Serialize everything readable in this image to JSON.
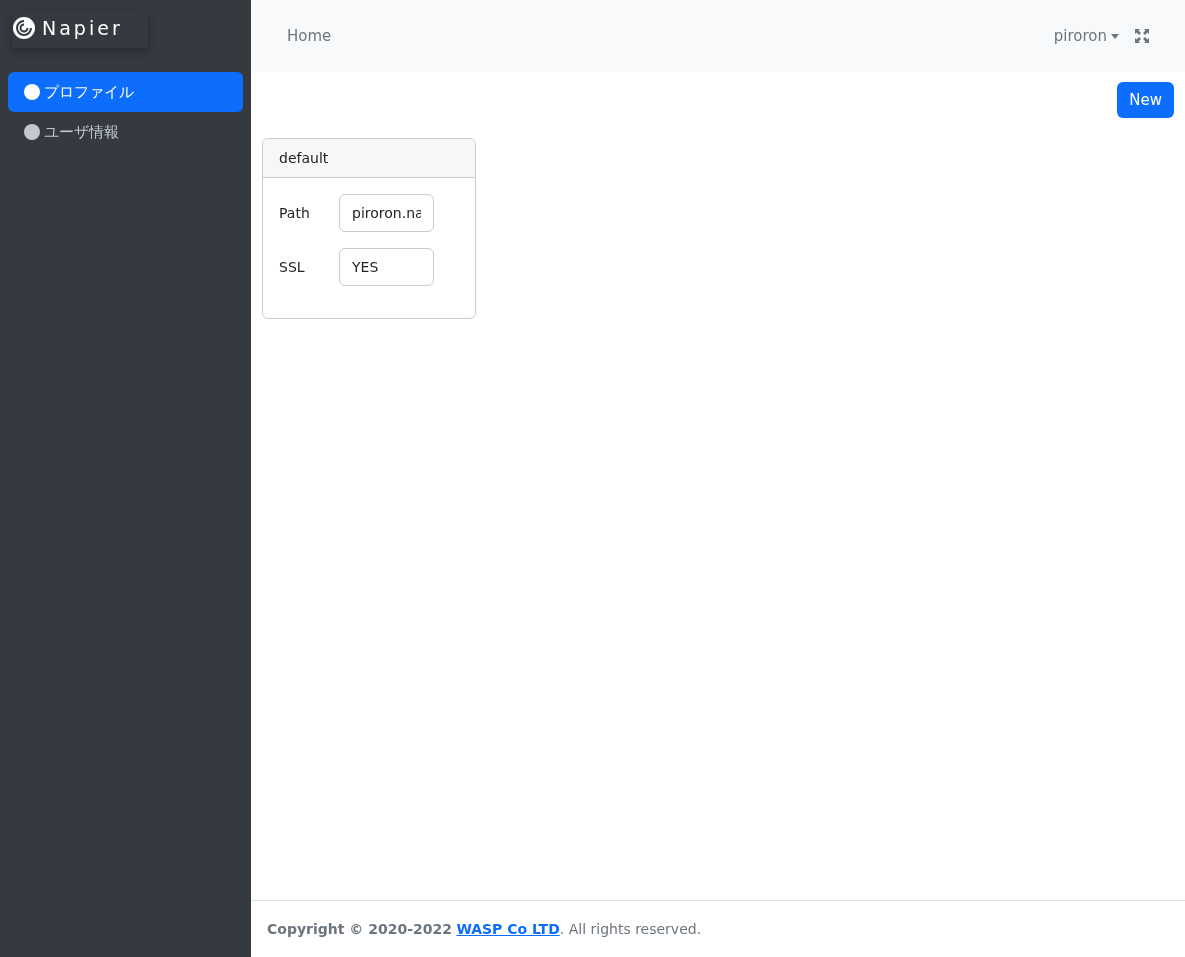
{
  "brand": "Napier",
  "sidebar": {
    "items": [
      {
        "label": "プロファイル",
        "selected": true
      },
      {
        "label": "ユーザ情報",
        "selected": false
      }
    ]
  },
  "navbar": {
    "link": "Home",
    "user": "piroron"
  },
  "new_button": "New",
  "profiles": [
    {
      "title": "default",
      "fields": [
        {
          "label": "Path",
          "value": "piroron.na"
        },
        {
          "label": "SSL",
          "value": "YES"
        }
      ]
    }
  ],
  "footer": {
    "prefix": "**Copyright © 2020-2022**",
    "link": "WASP Co LTD",
    "suffix": ". All rights reserved."
  }
}
